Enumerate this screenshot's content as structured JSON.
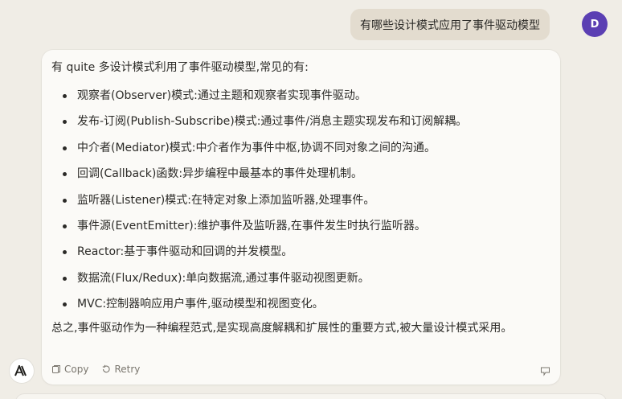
{
  "user_message": {
    "text": "有哪些设计模式应用了事件驱动模型",
    "avatar_letter": "D",
    "avatar_color": "#5b3fb3"
  },
  "assistant": {
    "intro": "有 quite 多设计模式利用了事件驱动模型,常见的有:",
    "bullets": [
      "观察者(Observer)模式:通过主题和观察者实现事件驱动。",
      "发布-订阅(Publish-Subscribe)模式:通过事件/消息主题实现发布和订阅解耦。",
      "中介者(Mediator)模式:中介者作为事件中枢,协调不同对象之间的沟通。",
      "回调(Callback)函数:异步编程中最基本的事件处理机制。",
      "监听器(Listener)模式:在特定对象上添加监听器,处理事件。",
      "事件源(EventEmitter):维护事件及监听器,在事件发生时执行监听器。",
      "Reactor:基于事件驱动和回调的并发模型。",
      "数据流(Flux/Redux):单向数据流,通过事件驱动视图更新。",
      "MVC:控制器响应用户事件,驱动模型和视图变化。"
    ],
    "summary": "总之,事件驱动作为一种编程范式,是实现高度解耦和扩展性的重要方式,被大量设计模式采用。",
    "actions": {
      "copy_label": "Copy",
      "retry_label": "Retry",
      "copy_icon": "copy-icon",
      "retry_icon": "retry-icon",
      "feedback_icon": "thumbs-down-icon"
    }
  },
  "logo": {
    "name": "claude-logo-icon"
  }
}
